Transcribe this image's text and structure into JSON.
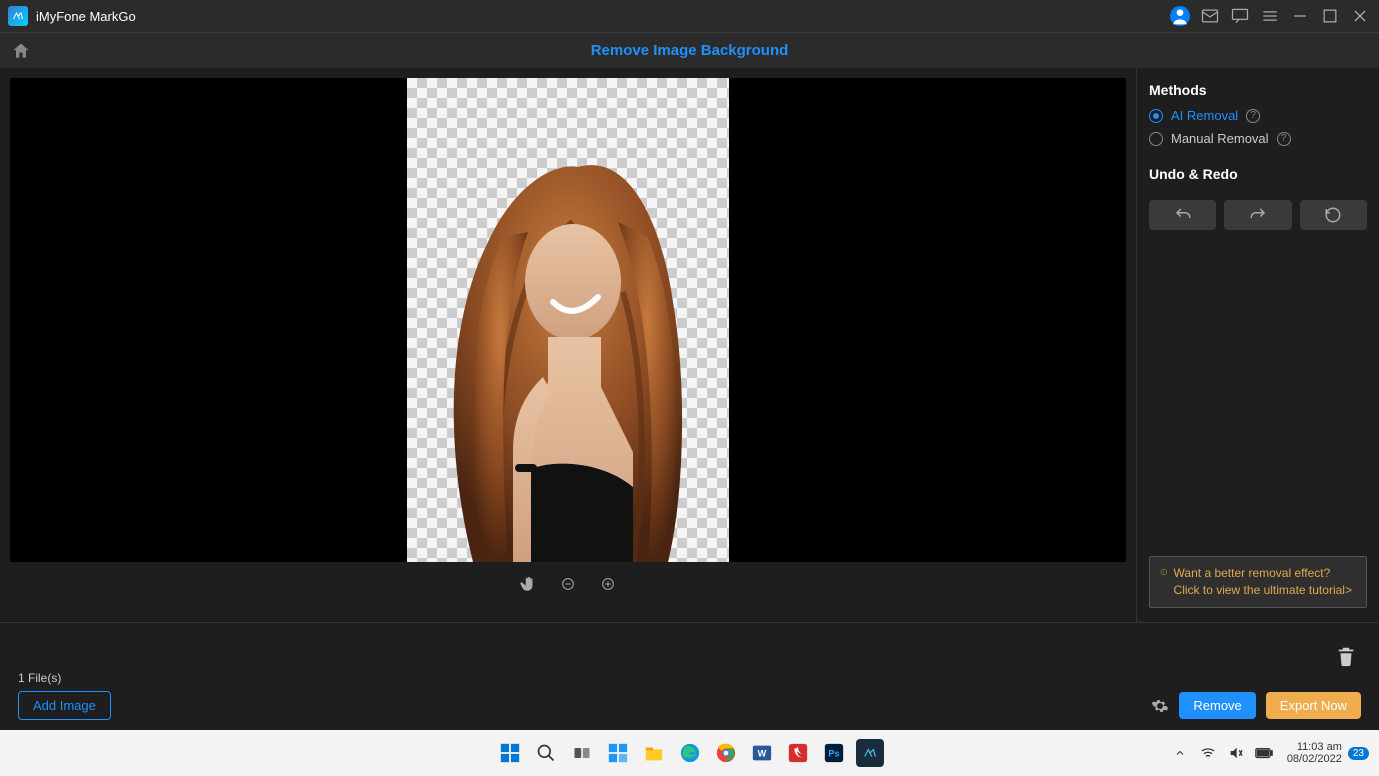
{
  "titlebar": {
    "app_name": "iMyFone MarkGo"
  },
  "toolbar": {
    "tab_title": "Remove Image Background"
  },
  "panel": {
    "methods_title": "Methods",
    "options": [
      {
        "label": "AI Removal",
        "selected": true
      },
      {
        "label": "Manual Removal",
        "selected": false
      }
    ],
    "undo_title": "Undo & Redo",
    "tip": "Want a better removal effect? Click to view the ultimate tutorial>"
  },
  "footer": {
    "file_count": "1 File(s)",
    "add_image": "Add Image",
    "remove": "Remove",
    "export": "Export Now"
  },
  "taskbar": {
    "time": "11:03 am",
    "date": "08/02/2022",
    "notif_count": "23"
  }
}
